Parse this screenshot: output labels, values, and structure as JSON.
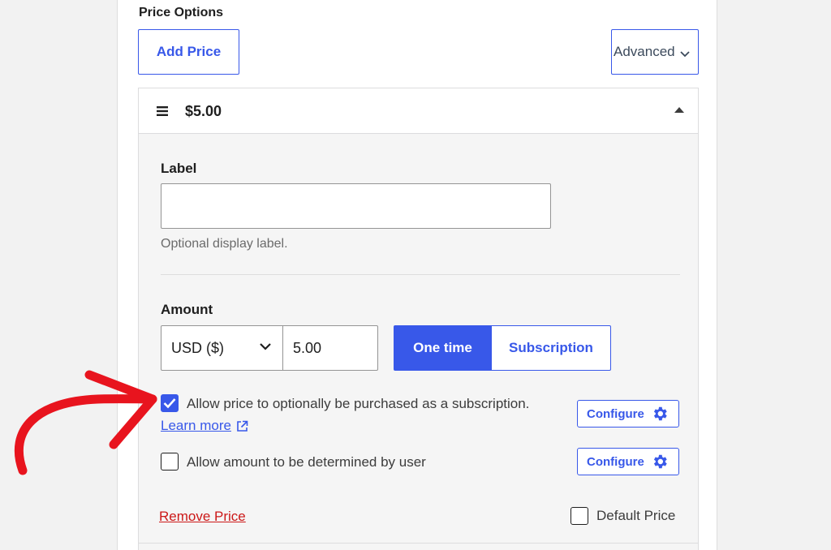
{
  "section": {
    "title": "Price Options"
  },
  "toolbar": {
    "add_price_label": "Add Price",
    "advanced_label": "Advanced"
  },
  "price_card": {
    "header_price": "$5.00",
    "label_field": {
      "title": "Label",
      "value": "",
      "placeholder": "",
      "help": "Optional display label."
    },
    "amount": {
      "title": "Amount",
      "currency_selected": "USD ($)",
      "value": "5.00",
      "toggle": {
        "one_time": "One time",
        "subscription": "Subscription",
        "active": "one_time"
      }
    },
    "options": [
      {
        "label": "Allow price to optionally be purchased as a subscription.",
        "checked": true,
        "configure_label": "Configure"
      },
      {
        "label": "Allow amount to be determined by user",
        "checked": false,
        "configure_label": "Configure"
      }
    ],
    "learn_more_label": "Learn more",
    "remove_label": "Remove Price",
    "default_label": "Default Price",
    "default_checked": false
  },
  "colors": {
    "accent": "#3858e9",
    "danger": "#cc1818",
    "annotation": "#e8141e"
  },
  "icons": [
    "drag-handle-icon",
    "collapse-caret-icon",
    "chevron-down-icon",
    "external-link-icon",
    "gear-icon",
    "checkmark-icon",
    "annotation-arrow"
  ]
}
